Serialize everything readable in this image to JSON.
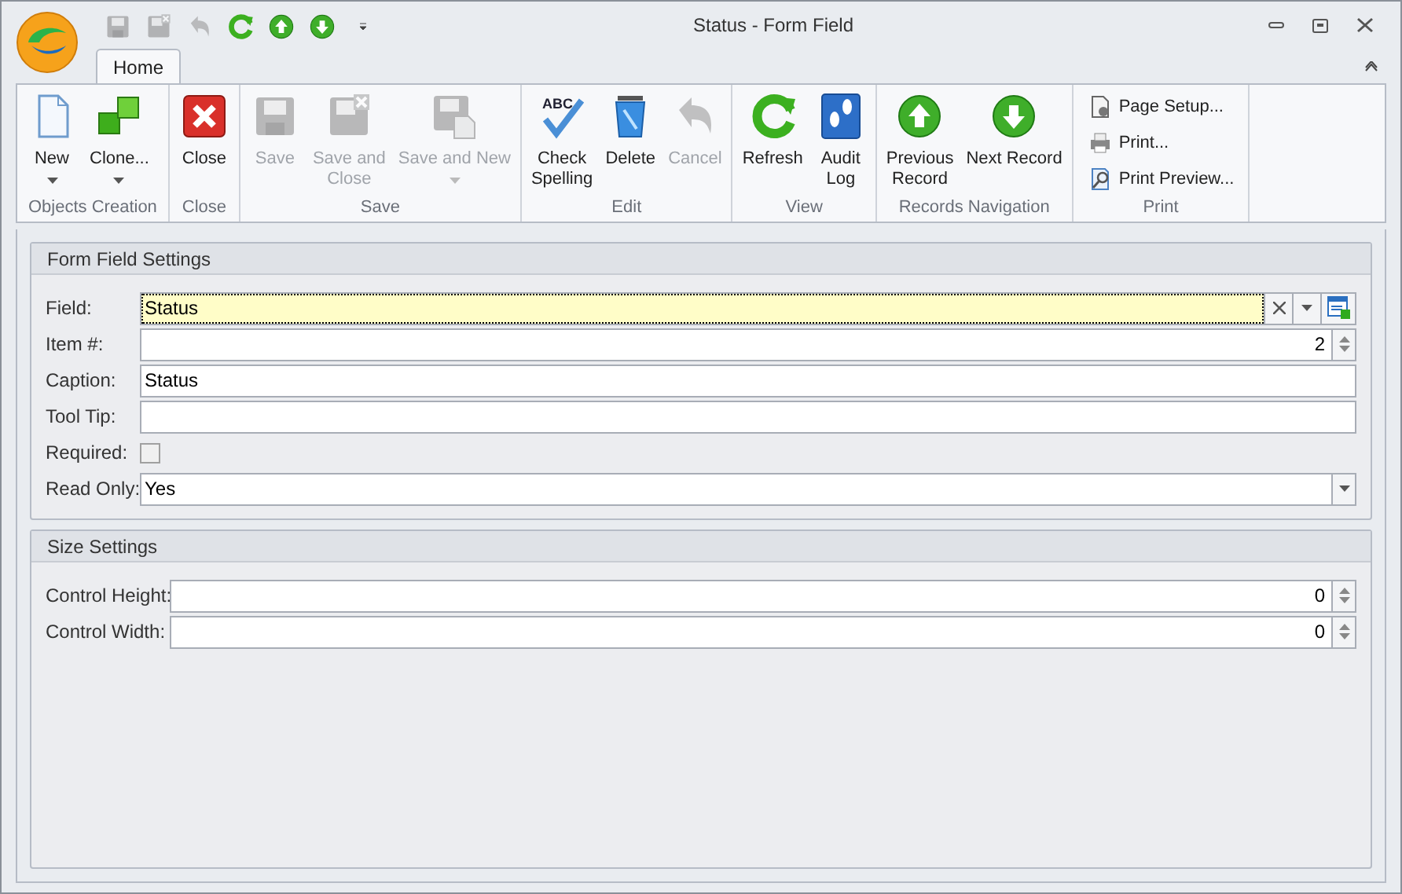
{
  "window": {
    "title": "Status - Form Field"
  },
  "quick_access": [
    {
      "kind": "save",
      "disabled": true
    },
    {
      "kind": "save_close",
      "disabled": true
    },
    {
      "kind": "undo",
      "disabled": true
    },
    {
      "kind": "refresh",
      "disabled": false
    },
    {
      "kind": "up",
      "disabled": false
    },
    {
      "kind": "down",
      "disabled": false
    },
    {
      "kind": "customize",
      "disabled": false
    }
  ],
  "tabs": [
    {
      "label": "Home",
      "selected": true
    }
  ],
  "ribbon_groups": [
    {
      "title": "Objects Creation",
      "buttons": [
        {
          "label": "New",
          "kind": "new",
          "disabled": false,
          "dropdown": true
        },
        {
          "label": "Clone...",
          "kind": "clone",
          "disabled": false,
          "dropdown": true
        }
      ]
    },
    {
      "title": "Close",
      "buttons": [
        {
          "label": "Close",
          "kind": "close",
          "disabled": false,
          "dropdown": false
        }
      ]
    },
    {
      "title": "Save",
      "buttons": [
        {
          "label": "Save",
          "kind": "save",
          "disabled": true,
          "dropdown": false
        },
        {
          "label": "Save and\nClose",
          "kind": "save_close",
          "disabled": true,
          "dropdown": false
        },
        {
          "label": "Save and New",
          "kind": "save_new",
          "disabled": true,
          "dropdown": true
        }
      ]
    },
    {
      "title": "Edit",
      "buttons": [
        {
          "label": "Check\nSpelling",
          "kind": "spelling",
          "icon_text": "ABC",
          "disabled": false,
          "dropdown": false
        },
        {
          "label": "Delete",
          "kind": "delete",
          "disabled": false,
          "dropdown": false
        },
        {
          "label": "Cancel",
          "kind": "undo",
          "disabled": true,
          "dropdown": false
        }
      ]
    },
    {
      "title": "View",
      "buttons": [
        {
          "label": "Refresh",
          "kind": "refresh",
          "disabled": false,
          "dropdown": false
        },
        {
          "label": "Audit\nLog",
          "kind": "audit",
          "disabled": false,
          "dropdown": false
        }
      ]
    },
    {
      "title": "Records Navigation",
      "buttons": [
        {
          "label": "Previous\nRecord",
          "kind": "up",
          "disabled": false,
          "dropdown": false
        },
        {
          "label": "Next Record",
          "kind": "down",
          "disabled": false,
          "dropdown": false
        }
      ]
    },
    {
      "title": "Print",
      "small_buttons": [
        {
          "label": "Page Setup...",
          "kind": "page_setup"
        },
        {
          "label": "Print...",
          "kind": "printer"
        },
        {
          "label": "Print Preview...",
          "kind": "preview"
        }
      ]
    }
  ],
  "sections": [
    {
      "title": "Form Field Settings",
      "fields": [
        {
          "label": "Field:",
          "kind": "lookup",
          "value": "Status",
          "focused": true
        },
        {
          "label": "Item #:",
          "kind": "spin",
          "value": "2",
          "focused": false
        },
        {
          "label": "Caption:",
          "kind": "text",
          "value": "Status",
          "focused": false
        },
        {
          "label": "Tool Tip:",
          "kind": "text",
          "focused": false
        },
        {
          "label": "Required:",
          "kind": "checkbox",
          "checked": false
        },
        {
          "label": "Read Only:",
          "kind": "dropdown",
          "value": "Yes",
          "focused": false
        }
      ]
    },
    {
      "title": "Size Settings",
      "fields": [
        {
          "label": "Control Height:",
          "kind": "spin",
          "value": "0",
          "focused": false
        },
        {
          "label": "Control Width:",
          "kind": "spin",
          "value": "0",
          "focused": false
        }
      ]
    }
  ]
}
